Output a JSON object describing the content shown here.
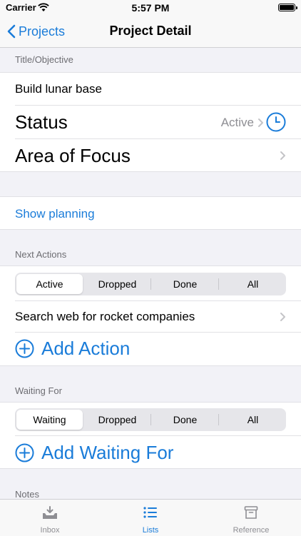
{
  "status_bar": {
    "carrier": "Carrier",
    "time": "5:57 PM"
  },
  "nav": {
    "back_label": "Projects",
    "title": "Project Detail"
  },
  "title_section": {
    "header": "Title/Objective",
    "value": "Build lunar base"
  },
  "status_row": {
    "label": "Status",
    "value": "Active"
  },
  "area_row": {
    "label": "Area of Focus"
  },
  "planning": {
    "link": "Show planning"
  },
  "next_actions": {
    "header": "Next Actions",
    "segments": [
      "Active",
      "Dropped",
      "Done",
      "All"
    ],
    "selected": "Active",
    "items": [
      "Search web for rocket companies"
    ],
    "add_label": "Add Action"
  },
  "waiting_for": {
    "header": "Waiting For",
    "segments": [
      "Waiting",
      "Dropped",
      "Done",
      "All"
    ],
    "selected": "Waiting",
    "add_label": "Add Waiting For"
  },
  "notes": {
    "header": "Notes"
  },
  "tabs": [
    {
      "label": "Inbox",
      "icon": "inbox-icon",
      "active": false
    },
    {
      "label": "Lists",
      "icon": "list-icon",
      "active": true
    },
    {
      "label": "Reference",
      "icon": "archive-icon",
      "active": false
    }
  ],
  "colors": {
    "accent": "#1a7cd9",
    "background": "#f2f2f7",
    "secondary_text": "#8e8e93"
  }
}
